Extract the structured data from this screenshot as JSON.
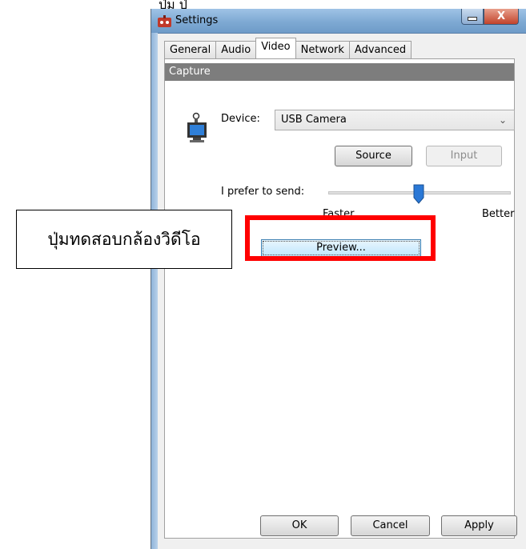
{
  "top_cut_text": "ปุ่ม            ปุ่",
  "window": {
    "title": "Settings",
    "close_glyph": "X"
  },
  "tabs": [
    {
      "label": "General",
      "active": false
    },
    {
      "label": "Audio",
      "active": false
    },
    {
      "label": "Video",
      "active": true
    },
    {
      "label": "Network",
      "active": false
    },
    {
      "label": "Advanced",
      "active": false
    }
  ],
  "capture": {
    "section_title": "Capture",
    "device_label": "Device:",
    "device_value": "USB Camera",
    "source_label": "Source",
    "input_label": "Input",
    "prefer_label": "I prefer to send:",
    "slider_min_label": "Faster",
    "slider_max_label": "Better",
    "slider_value_fraction": 0.5,
    "preview_label": "Preview..."
  },
  "footer": {
    "ok_label": "OK",
    "cancel_label": "Cancel",
    "apply_label": "Apply"
  },
  "annotation": {
    "callout_text": "ปุ่มทดสอบกล้องวิดีโอ",
    "highlight_color": "#ff0000"
  },
  "colors": {
    "section_bar": "#7d7d7d",
    "title_gradient_top": "#9fc3e6",
    "preview_border": "#3c7fb1"
  }
}
